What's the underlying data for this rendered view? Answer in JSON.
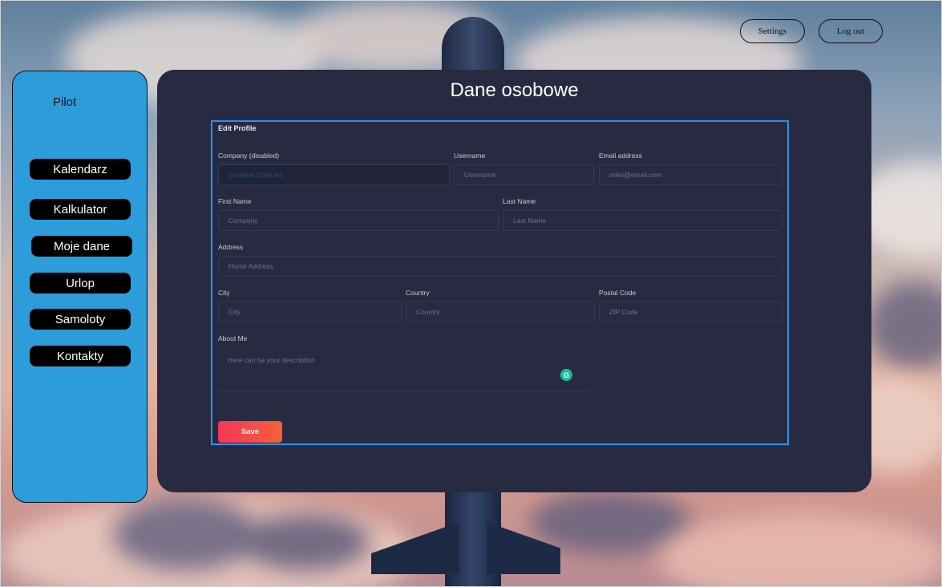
{
  "header": {
    "settings_label": "Settings",
    "logout_label": "Log out"
  },
  "sidebar": {
    "role": "Pilot",
    "items": [
      {
        "label": "Kalendarz"
      },
      {
        "label": "Kalkulator"
      },
      {
        "label": "Moje dane"
      },
      {
        "label": "Urlop"
      },
      {
        "label": "Samoloty"
      },
      {
        "label": "Kontakty"
      }
    ]
  },
  "main": {
    "title": "Dane osobowe"
  },
  "form": {
    "section_title": "Edit Profile",
    "company": {
      "label": "Company (disabled)",
      "value": "Creative Code Inc."
    },
    "username": {
      "label": "Username",
      "placeholder": "Username"
    },
    "email": {
      "label": "Email address",
      "placeholder": "mike@email.com"
    },
    "first_name": {
      "label": "First Name",
      "placeholder": "Company"
    },
    "last_name": {
      "label": "Last Name",
      "placeholder": "Last Name"
    },
    "address": {
      "label": "Address",
      "placeholder": "Home Address"
    },
    "city": {
      "label": "City",
      "placeholder": "City"
    },
    "country": {
      "label": "Country",
      "placeholder": "Country"
    },
    "postal": {
      "label": "Postal Code",
      "placeholder": "ZIP Code"
    },
    "about": {
      "label": "About Me",
      "placeholder": "Here can be your description"
    },
    "grammarly_icon": "G",
    "save_label": "Save"
  },
  "colors": {
    "sidebar": "#2d9cdb",
    "panel": "#272a40",
    "form_border": "#2196f3",
    "save": "#f5365c"
  }
}
